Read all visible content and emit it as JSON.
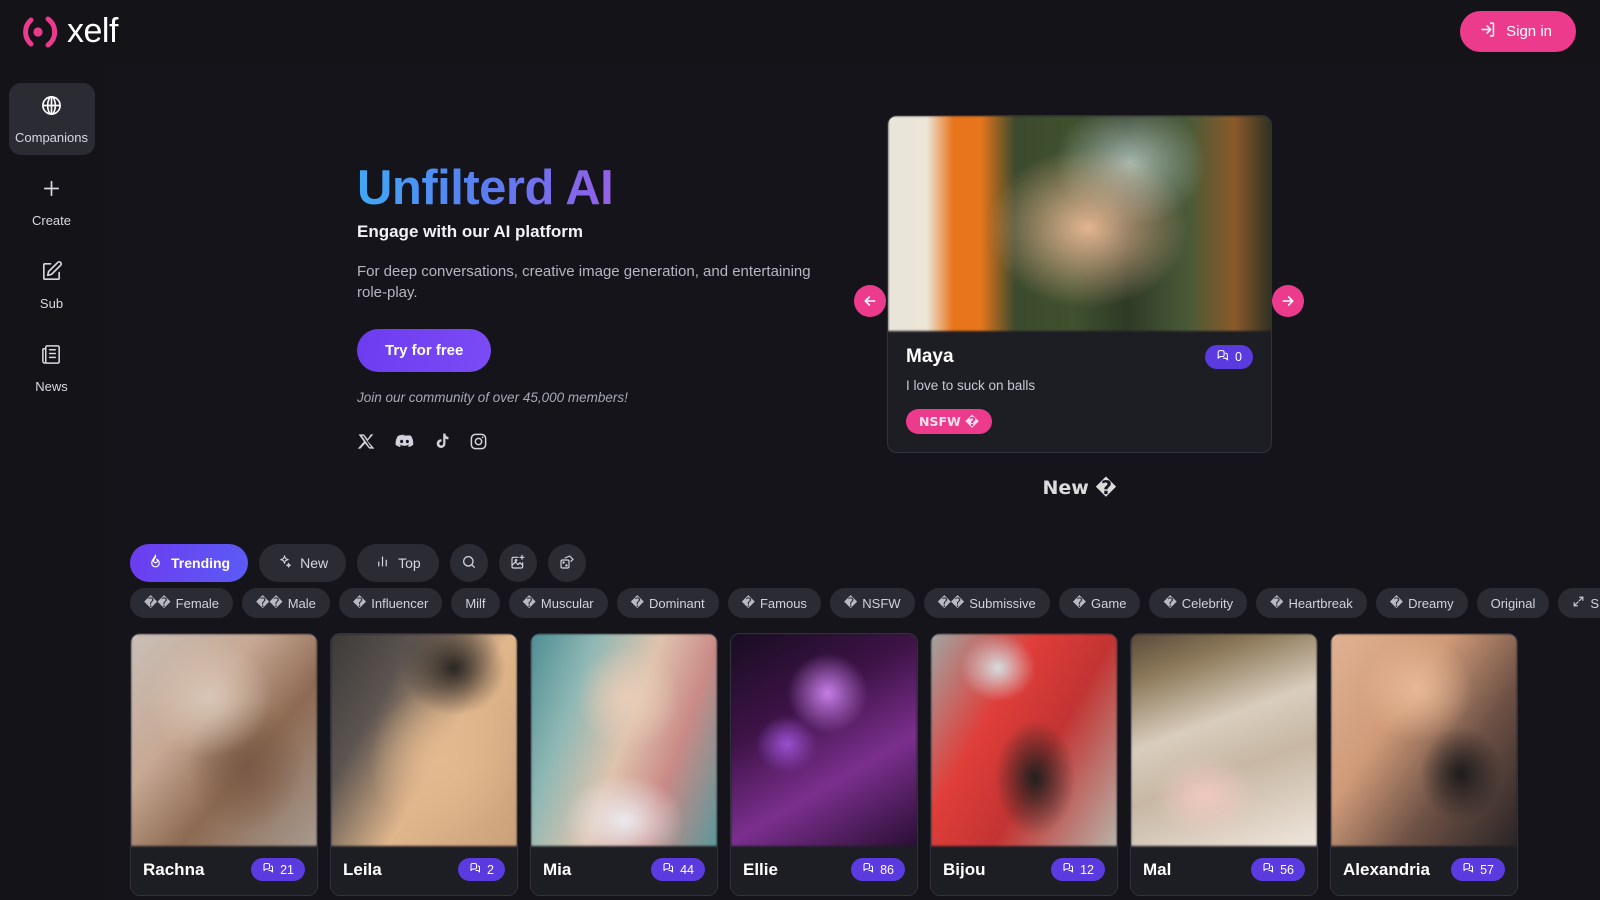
{
  "topbar": {
    "logo_text": "xelf",
    "logo_icon": "xelf-mark-icon",
    "signin_label": "Sign in",
    "signin_icon": "login-arrow-icon",
    "accent_pink": "#ec3b8c",
    "bar_bg": "#131318"
  },
  "sidebar": {
    "items": [
      {
        "label": "Companions",
        "icon": "globe-icon",
        "active": true
      },
      {
        "label": "Create",
        "icon": "plus-icon",
        "active": false
      },
      {
        "label": "Sub",
        "icon": "pencil-square-icon",
        "active": false
      },
      {
        "label": "News",
        "icon": "newspaper-icon",
        "active": false
      }
    ]
  },
  "hero": {
    "title": "Unfilterd AI",
    "subtitle": "Engage with our AI platform",
    "paragraph": "For deep conversations, creative image generation, and entertaining role-play.",
    "cta_label": "Try for free",
    "note": "Join our community of over 45,000 members!",
    "socials": [
      {
        "name": "x-twitter-icon"
      },
      {
        "name": "discord-icon"
      },
      {
        "name": "tiktok-icon"
      },
      {
        "name": "instagram-icon"
      }
    ],
    "gradient_from": "#3fa9f5",
    "gradient_to": "#ef5ca8"
  },
  "carousel": {
    "prev_icon": "arrow-left-icon",
    "next_icon": "arrow-right-icon",
    "caption": "New �",
    "card": {
      "name": "Maya",
      "description": "I love to suck on balls",
      "chat_count": "0",
      "chat_icon": "chat-bubbles-icon",
      "nsfw_label": "NSFW �",
      "badge_color": "#5b3ae0",
      "nsfw_color": "#ec3b8c"
    }
  },
  "filters": {
    "tabs": [
      {
        "label": "Trending",
        "icon": "flame-icon",
        "active": true
      },
      {
        "label": "New",
        "icon": "sparkles-icon",
        "active": false
      },
      {
        "label": "Top",
        "icon": "bar-chart-icon",
        "active": false
      }
    ],
    "icon_buttons": [
      {
        "name": "search-icon"
      },
      {
        "name": "image-plus-icon"
      },
      {
        "name": "dice-shuffle-icon"
      }
    ],
    "chips": [
      {
        "label": "Female",
        "emoji": "��"
      },
      {
        "label": "Male",
        "emoji": "��"
      },
      {
        "label": "Influencer",
        "emoji": "�"
      },
      {
        "label": "Milf",
        "emoji": ""
      },
      {
        "label": "Muscular",
        "emoji": "�"
      },
      {
        "label": "Dominant",
        "emoji": "�"
      },
      {
        "label": "Famous",
        "emoji": "�"
      },
      {
        "label": "NSFW",
        "emoji": "�"
      },
      {
        "label": "Submissive",
        "emoji": "��"
      },
      {
        "label": "Game",
        "emoji": "�"
      },
      {
        "label": "Celebrity",
        "emoji": "�"
      },
      {
        "label": "Heartbreak",
        "emoji": "�"
      },
      {
        "label": "Dreamy",
        "emoji": "�"
      },
      {
        "label": "Original",
        "emoji": ""
      },
      {
        "label": "Show all",
        "emoji": "",
        "icon": "expand-arrows-icon"
      }
    ]
  },
  "grid": {
    "cards": [
      {
        "name": "Rachna",
        "chat_count": "21"
      },
      {
        "name": "Leila",
        "chat_count": "2"
      },
      {
        "name": "Mia",
        "chat_count": "44"
      },
      {
        "name": "Ellie",
        "chat_count": "86"
      },
      {
        "name": "Bijou",
        "chat_count": "12"
      },
      {
        "name": "Mal",
        "chat_count": "56"
      },
      {
        "name": "Alexandria",
        "chat_count": "57"
      }
    ]
  }
}
